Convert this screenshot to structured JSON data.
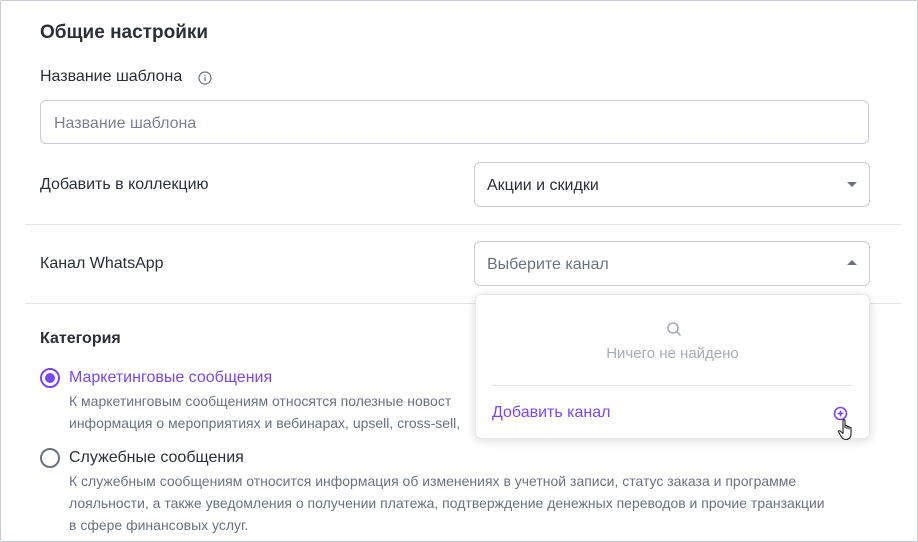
{
  "section": {
    "title": "Общие настройки"
  },
  "template_name": {
    "label": "Название шаблона",
    "placeholder": "Название шаблона"
  },
  "collection": {
    "label": "Добавить в коллекцию",
    "selected": "Акции и скидки"
  },
  "whatsapp_channel": {
    "label": "Канал WhatsApp",
    "placeholder": "Выберите канал",
    "dropdown": {
      "empty_text": "Ничего не найдено",
      "add_label": "Добавить канал"
    }
  },
  "category": {
    "title": "Категория",
    "options": [
      {
        "label": "Маркетинговые сообщения",
        "selected": true,
        "desc_lines": [
          "К маркетинговым сообщениям относятся полезные новост",
          "информация о мероприятиях и вебинарах, upsell, cross-sell,"
        ]
      },
      {
        "label": "Служебные сообщения",
        "selected": false,
        "desc_lines": [
          "К служебным сообщениям относится информация об изменениях в учетной записи, статус заказа и программе",
          "лояльности, а также уведомления о получении платежа, подтверждение денежных переводов и прочие транзакции",
          "в сфере финансовых услуг."
        ]
      }
    ]
  },
  "colors": {
    "accent": "#7b46f2",
    "text": "#2b2f38",
    "muted": "#6b7180",
    "border": "#c9ccd3"
  }
}
